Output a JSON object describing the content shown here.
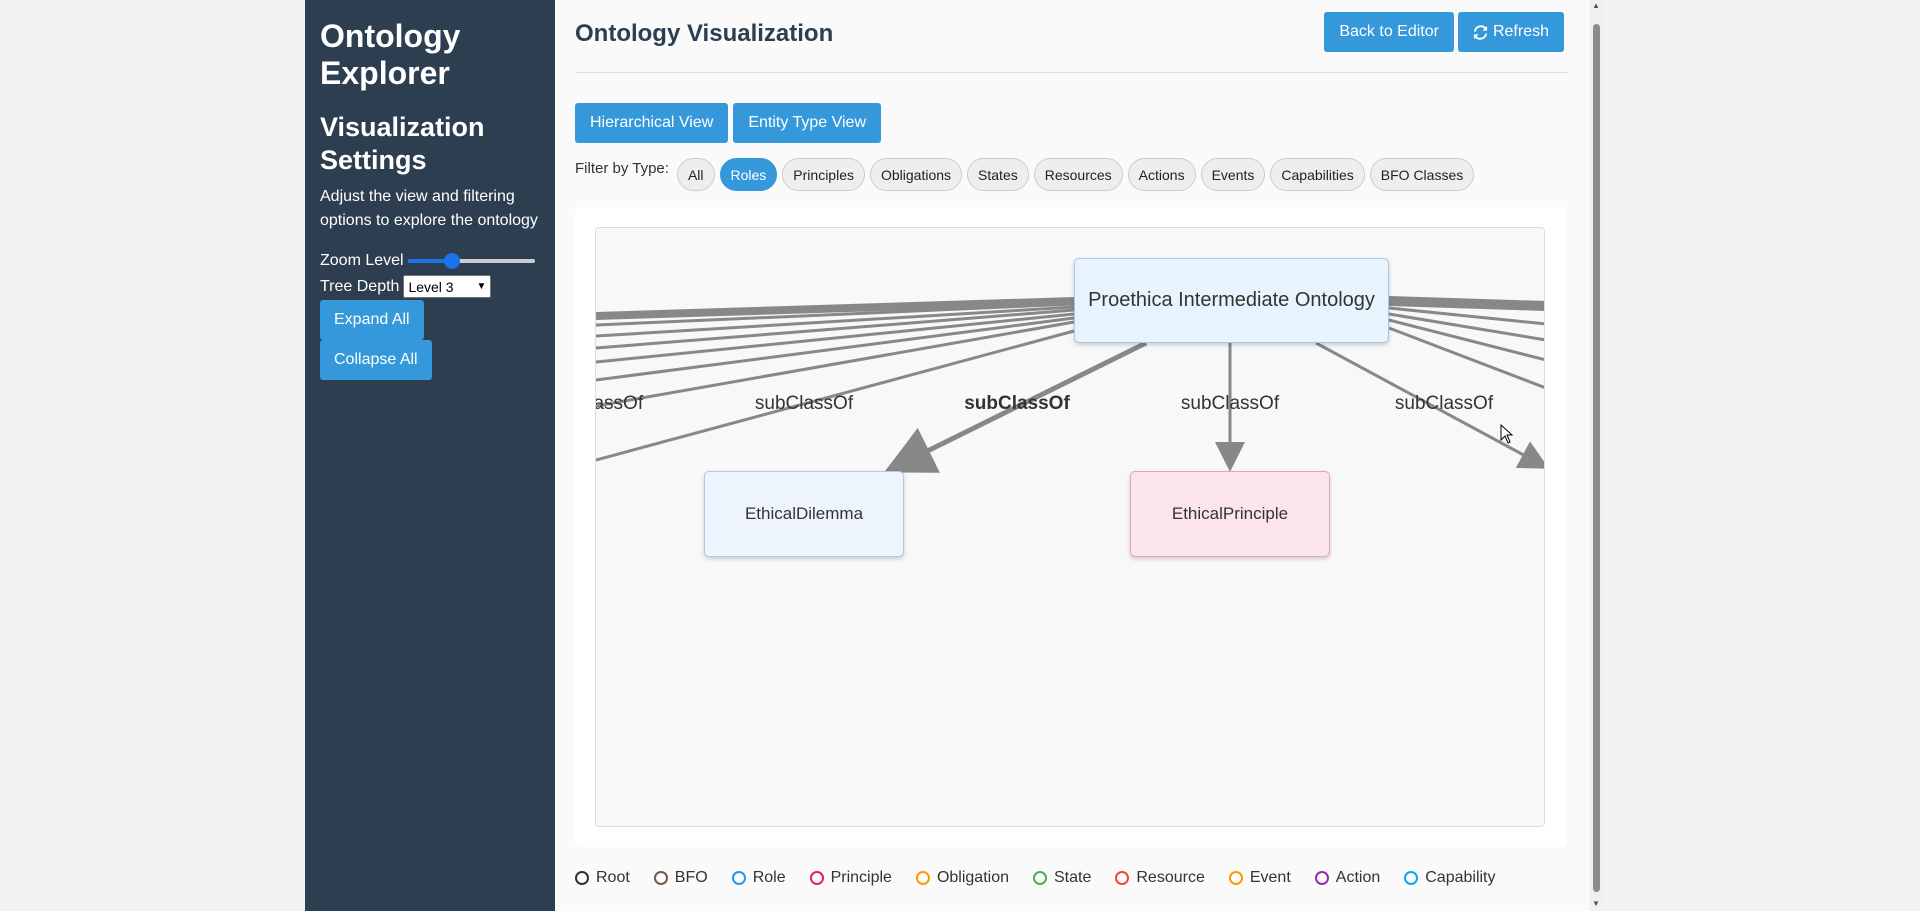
{
  "sidebar": {
    "title": "Ontology Explorer",
    "subtitle": "Visualization Settings",
    "description": "Adjust the view and filtering options to explore the ontology",
    "zoom_label": "Zoom Level",
    "zoom_value": 0.35,
    "depth_label": "Tree Depth",
    "depth_value": "Level 3",
    "expand_label": "Expand All",
    "collapse_label": "Collapse All"
  },
  "main": {
    "title": "Ontology Visualization",
    "back_label": "Back to Editor",
    "refresh_label": "Refresh",
    "view_buttons": [
      "Hierarchical View",
      "Entity Type View"
    ],
    "filter_label": "Filter by Type:",
    "filters": [
      "All",
      "Roles",
      "Principles",
      "Obligations",
      "States",
      "Resources",
      "Actions",
      "Events",
      "Capabilities",
      "BFO Classes"
    ],
    "active_filter": "Roles"
  },
  "graph": {
    "root": "Proethica Intermediate Ontology",
    "nodes": [
      "EthicalDilemma",
      "EthicalPrinciple"
    ],
    "edge_labels": [
      "subClassOf",
      "subClassOf",
      "subClassOf",
      "subClassOf",
      "subClassOf"
    ]
  },
  "legend": [
    {
      "label": "Root",
      "color": "#333333"
    },
    {
      "label": "BFO",
      "color": "#795548"
    },
    {
      "label": "Role",
      "color": "#2196f3"
    },
    {
      "label": "Principle",
      "color": "#e91e63"
    },
    {
      "label": "Obligation",
      "color": "#ff9800"
    },
    {
      "label": "State",
      "color": "#4caf50"
    },
    {
      "label": "Resource",
      "color": "#f44336"
    },
    {
      "label": "Event",
      "color": "#ff9800"
    },
    {
      "label": "Action",
      "color": "#9c27b0"
    },
    {
      "label": "Capability",
      "color": "#03a9f4"
    }
  ],
  "colors": {
    "sidebar_bg": "#2c3e50",
    "accent": "#3498db",
    "edge": "#888888"
  }
}
